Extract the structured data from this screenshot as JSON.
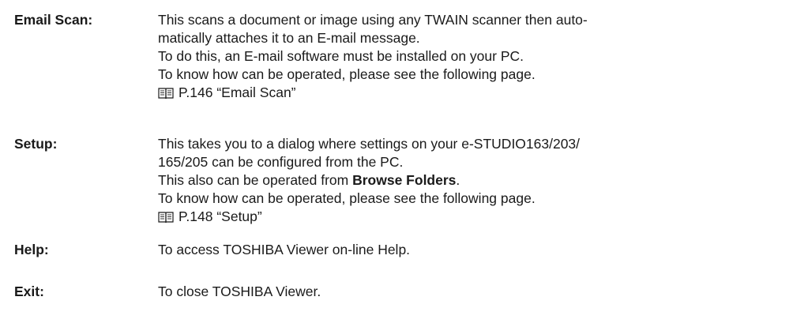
{
  "entries": [
    {
      "term": "Email Scan:",
      "lines": [
        "This scans a document or image using any TWAIN scanner then auto-",
        "matically attaches it to an E-mail message.",
        "To do this, an E-mail software must be installed on your PC.",
        "To know how can be operated, please see the following page."
      ],
      "ref": "P.146 “Email Scan”"
    },
    {
      "term": "Setup:",
      "lines": [
        "This takes you to a dialog where settings on your e-STUDIO163/203/",
        "165/205 can be configured from the PC."
      ],
      "browse_prefix": "This also can be operated from ",
      "browse_bold": "Browse Folders",
      "browse_suffix": ".",
      "lines_after": [
        "To know how can be operated, please see the following page."
      ],
      "ref": "P.148 “Setup”"
    },
    {
      "term": "Help:",
      "lines": [
        "To access TOSHIBA Viewer on-line Help."
      ]
    },
    {
      "term": "Exit:",
      "lines": [
        "To close TOSHIBA Viewer."
      ]
    }
  ],
  "icons": {
    "reference": "book-reference-icon"
  }
}
